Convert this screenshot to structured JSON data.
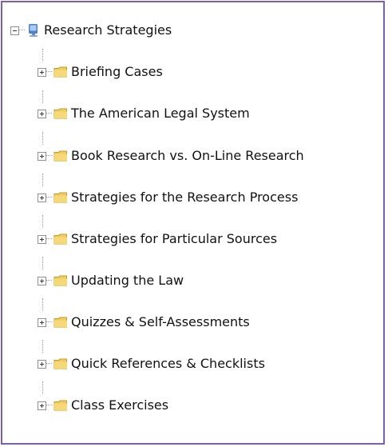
{
  "tree": {
    "root": {
      "label": "Research Strategies",
      "icon": "computer-icon"
    },
    "items": [
      {
        "label": "Briefing Cases",
        "icon": "folder-icon"
      },
      {
        "label": "The American Legal System",
        "icon": "folder-icon"
      },
      {
        "label": "Book Research vs. On-Line Research",
        "icon": "folder-icon"
      },
      {
        "label": "Strategies for the Research Process",
        "icon": "folder-icon"
      },
      {
        "label": "Strategies for Particular Sources",
        "icon": "folder-icon"
      },
      {
        "label": "Updating the Law",
        "icon": "folder-icon"
      },
      {
        "label": "Quizzes & Self-Assessments",
        "icon": "folder-icon"
      },
      {
        "label": "Quick References & Checklists",
        "icon": "folder-icon"
      },
      {
        "label": "Class Exercises",
        "icon": "folder-icon"
      }
    ]
  },
  "colors": {
    "border": "#7a5fb4",
    "folder": "#e9c14d"
  }
}
